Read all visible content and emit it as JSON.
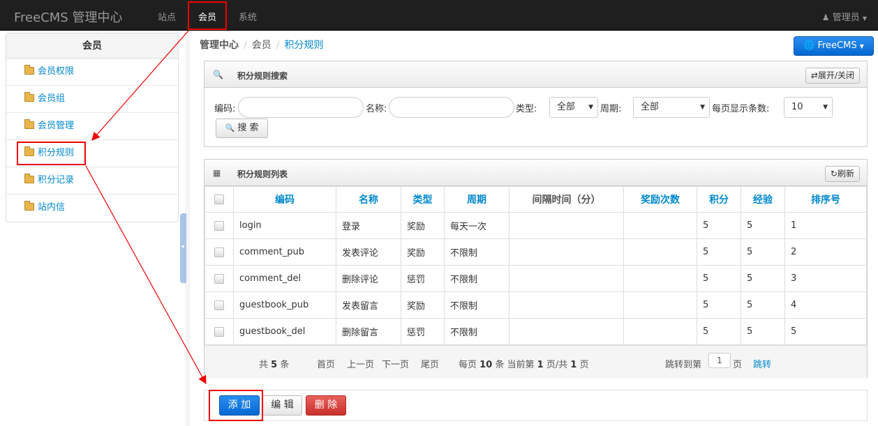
{
  "topbar": {
    "brand": "FreeCMS 管理中心",
    "nav": [
      {
        "label": "站点"
      },
      {
        "label": "会员"
      },
      {
        "label": "系统"
      }
    ],
    "user": "管理员"
  },
  "sidebar": {
    "title": "会员",
    "items": [
      {
        "label": "会员权限"
      },
      {
        "label": "会员组"
      },
      {
        "label": "会员管理"
      },
      {
        "label": "积分规则"
      },
      {
        "label": "积分记录"
      },
      {
        "label": "站内信"
      }
    ]
  },
  "breadcrumb": {
    "root": "管理中心",
    "sep": "/",
    "section": "会员",
    "current": "积分规则"
  },
  "brand_button": "FreeCMS",
  "search": {
    "title": "积分规则搜索",
    "toggle": "展开/关闭",
    "code_label": "编码:",
    "code_value": "",
    "name_label": "名称:",
    "name_value": "",
    "type_label": "类型:",
    "type_value": "全部",
    "period_label": "周期:",
    "period_value": "全部",
    "pagesize_label": "每页显示条数:",
    "pagesize_value": "10",
    "search_button": "搜 索"
  },
  "list": {
    "title": "积分规则列表",
    "refresh": "刷新",
    "columns": [
      "编码",
      "名称",
      "类型",
      "周期",
      "间隔时间（分）",
      "奖励次数",
      "积分",
      "经验",
      "排序号"
    ],
    "rows": [
      [
        "login",
        "登录",
        "奖励",
        "每天一次",
        "",
        "",
        "5",
        "5",
        "1"
      ],
      [
        "comment_pub",
        "发表评论",
        "奖励",
        "不限制",
        "",
        "",
        "5",
        "5",
        "2"
      ],
      [
        "comment_del",
        "删除评论",
        "惩罚",
        "不限制",
        "",
        "",
        "5",
        "5",
        "3"
      ],
      [
        "guestbook_pub",
        "发表留言",
        "奖励",
        "不限制",
        "",
        "",
        "5",
        "5",
        "4"
      ],
      [
        "guestbook_del",
        "删除留言",
        "惩罚",
        "不限制",
        "",
        "",
        "5",
        "5",
        "5"
      ]
    ]
  },
  "pager": {
    "total_pre": "共",
    "total": "5",
    "total_post": "条",
    "first": "首页",
    "prev": "上一页",
    "next": "下一页",
    "last": "尾页",
    "per_pre": "每页",
    "per": "10",
    "per_mid": "条 当前第",
    "cur": "1",
    "cur_mid": "页/共",
    "pages": "1",
    "pages_post": "页",
    "jump_pre": "跳转到第",
    "jump_value": "1",
    "jump_post": "页",
    "jump": "跳转"
  },
  "actions": {
    "add": "添 加",
    "edit": "编 辑",
    "delete": "删 除"
  },
  "colors": {
    "accent": "#0088cc",
    "highlight": "#ee0000",
    "primary_button": "#0568d3",
    "danger_button": "#c9302c"
  }
}
